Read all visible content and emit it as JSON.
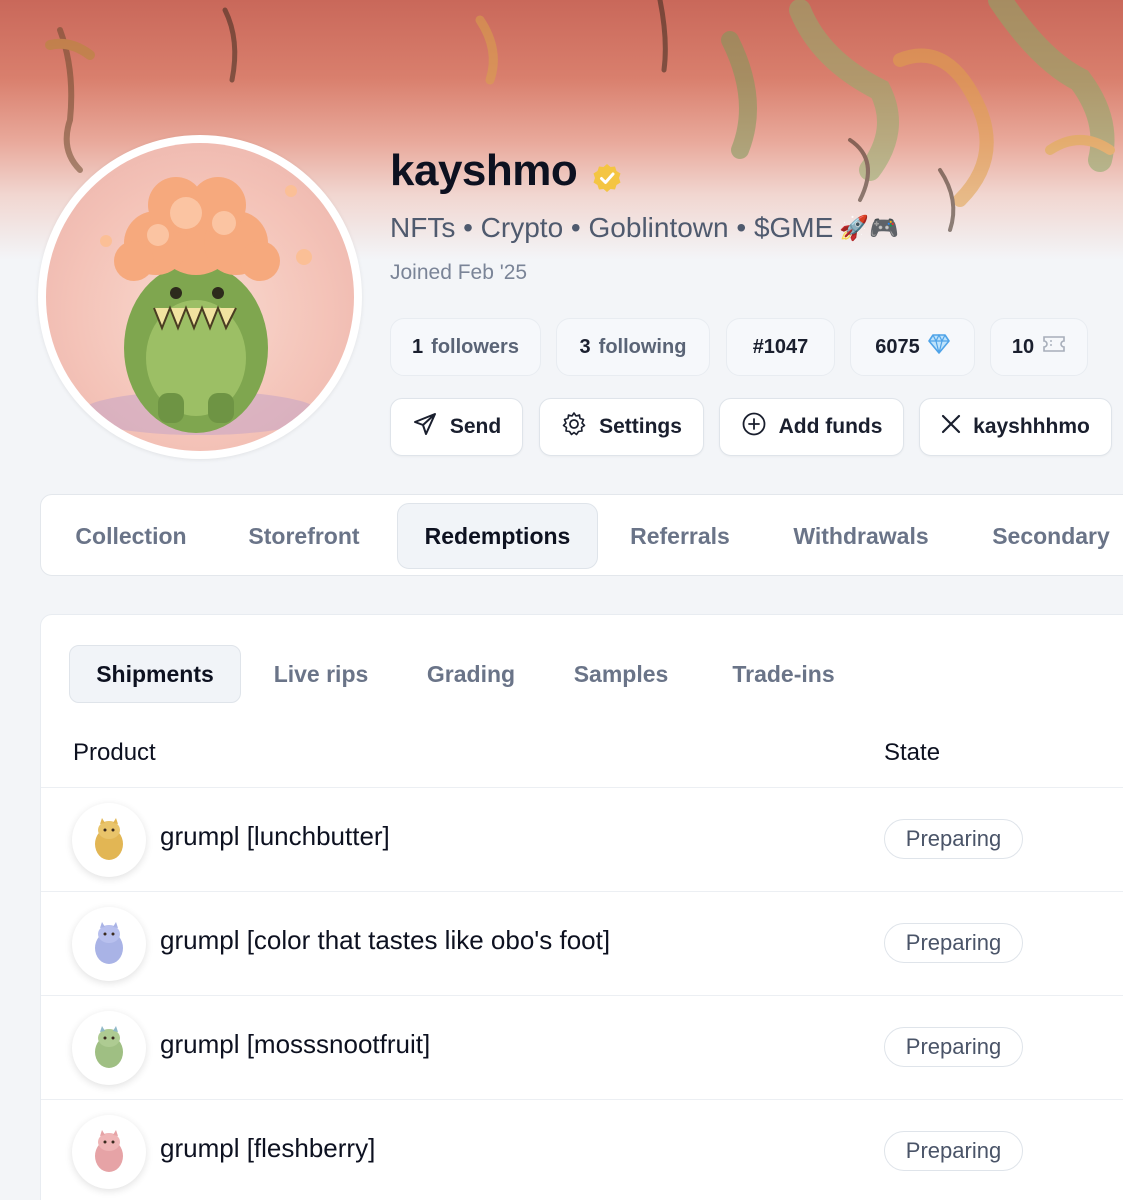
{
  "profile": {
    "username": "kayshmo",
    "bio": "NFTs • Crypto • Goblintown • $GME",
    "bio_emoji": "🚀🎮",
    "joined": "Joined Feb '25",
    "verified_color": "#f4c542"
  },
  "stats": {
    "followers_count": "1",
    "followers_label": "followers",
    "following_count": "3",
    "following_label": "following",
    "rank": "#1047",
    "gems": "6075",
    "gem_icon": "diamond-icon",
    "tickets": "10",
    "ticket_icon": "ticket-icon"
  },
  "actions": {
    "send": "Send",
    "settings": "Settings",
    "add_funds": "Add funds",
    "x_handle": "kayshhhmo"
  },
  "main_tabs": [
    {
      "label": "Collection"
    },
    {
      "label": "Storefront"
    },
    {
      "label": "Redemptions",
      "active": true
    },
    {
      "label": "Referrals"
    },
    {
      "label": "Withdrawals"
    },
    {
      "label": "Secondary"
    }
  ],
  "sub_tabs": [
    {
      "label": "Shipments",
      "active": true
    },
    {
      "label": "Live rips"
    },
    {
      "label": "Grading"
    },
    {
      "label": "Samples"
    },
    {
      "label": "Trade-ins"
    }
  ],
  "table": {
    "col_product": "Product",
    "col_state": "State",
    "rows": [
      {
        "product": "grumpl [lunchbutter]",
        "state": "Preparing",
        "color": "#e2b654"
      },
      {
        "product": "grumpl [color that tastes like obo's foot]",
        "state": "Preparing",
        "color": "#a9b3e6"
      },
      {
        "product": "grumpl [mosssnootfruit]",
        "state": "Preparing",
        "color": "#9fbf83"
      },
      {
        "product": "grumpl [fleshberry]",
        "state": "Preparing",
        "color": "#e6a3a6"
      }
    ]
  },
  "colors": {
    "accent_diamond": "#4fa3e8",
    "text_primary": "#0d1120",
    "text_muted": "#6a7488"
  }
}
